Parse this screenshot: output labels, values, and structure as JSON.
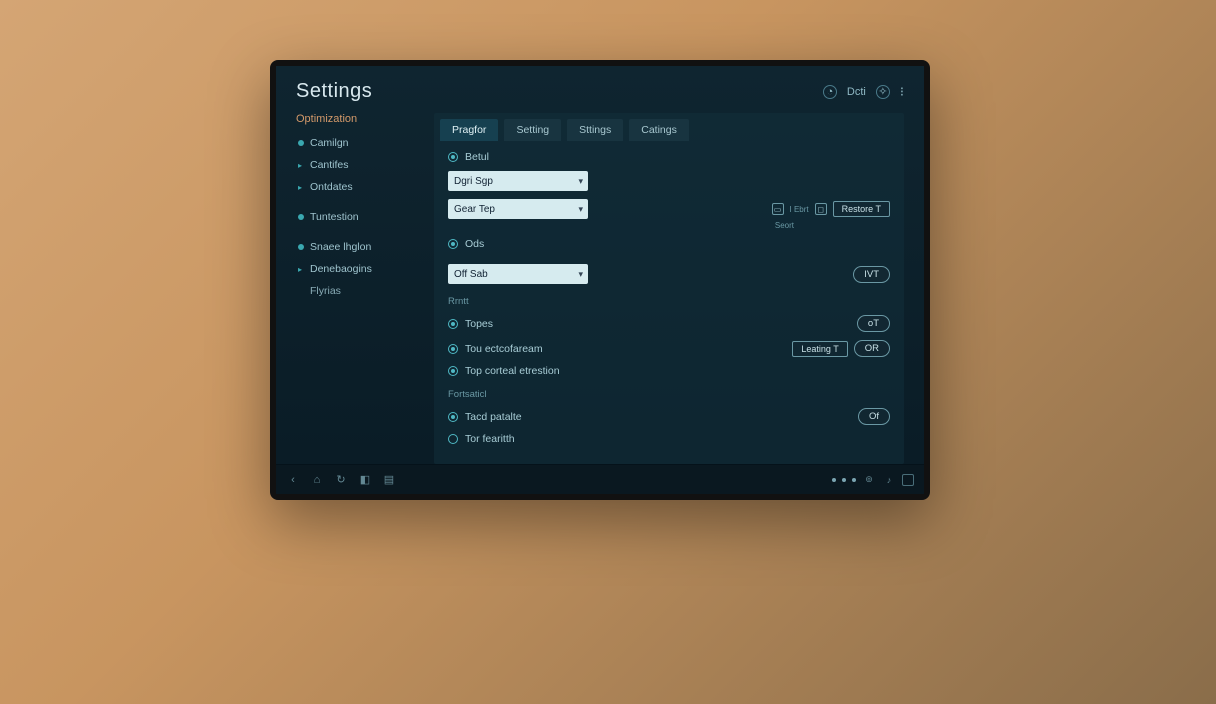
{
  "header": {
    "title": "Settings",
    "user_label": "Dсti"
  },
  "sidebar": {
    "heading": "Optimization",
    "items": [
      {
        "label": "Camilgn",
        "kind": "dot"
      },
      {
        "label": "Cantifes",
        "kind": "chev"
      },
      {
        "label": "Ontdates",
        "kind": "chev"
      },
      {
        "label": "Tuntestion",
        "kind": "dot"
      },
      {
        "label": "Snaee lhglon",
        "kind": "dot"
      },
      {
        "label": "Denebaogins",
        "kind": "chev"
      },
      {
        "label": "Flyrias",
        "kind": "sub"
      }
    ]
  },
  "tabs": [
    {
      "label": "Pragfor",
      "active": true
    },
    {
      "label": "Setting",
      "active": false
    },
    {
      "label": "Sttings",
      "active": false
    },
    {
      "label": "Catings",
      "active": false
    }
  ],
  "form": {
    "radio1": "Betul",
    "select1": "Dgri Sgp",
    "select2": "Gear Tep",
    "radio2": "Ods",
    "select3": "Off Sab",
    "group2_label": "Rrntt",
    "check1": "Topes",
    "check2": "Tou ectcofaream",
    "check3": "Top corteal etrestion",
    "group3_label": "Fortsaticl",
    "check4": "Tacd patalte",
    "check5": "Tor fearitth",
    "right_meta1": "I Ebrt",
    "right_meta2": "Seort",
    "btn_restore": "Restore T",
    "pill_ivt": "IVT",
    "pill_ot": "oT",
    "pill_or": "OR",
    "pill_of": "Of",
    "btn_leating": "Leating T"
  },
  "colors": {
    "bg": "#0f2530",
    "panel": "#123844",
    "accent": "#3aa8b0",
    "sidebar_heading": "#d49a6a",
    "text": "#b8d4dc"
  }
}
